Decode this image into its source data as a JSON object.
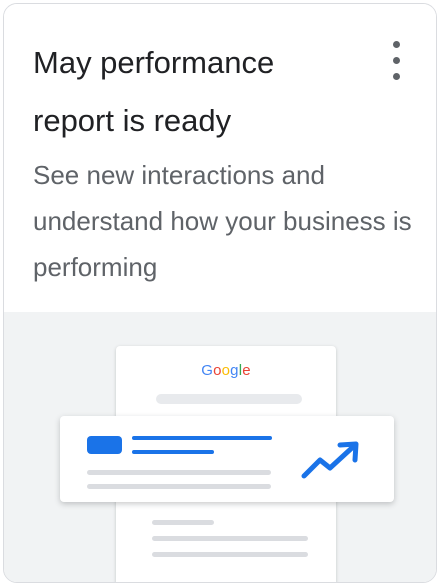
{
  "card": {
    "title": "May performance report is ready",
    "description": "See new interactions and understand how your business is performing",
    "menu_icon": "more-vert-icon"
  },
  "illustration": {
    "logo_letters": [
      "G",
      "o",
      "o",
      "g",
      "l",
      "e"
    ],
    "trend_icon": "trending-up-icon"
  },
  "colors": {
    "title_text": "#202124",
    "body_text": "#5f6368",
    "accent_blue": "#1a73e8",
    "illustration_bg": "#f1f3f4",
    "card_border": "#dadce0"
  }
}
